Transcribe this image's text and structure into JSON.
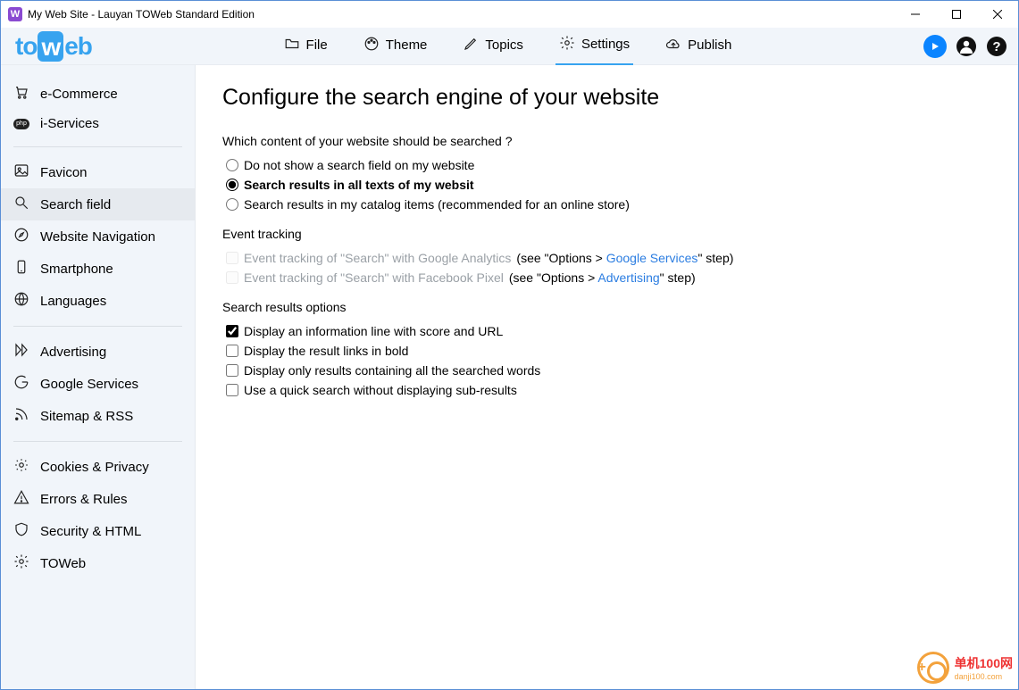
{
  "window": {
    "title": "My Web Site - Lauyan TOWeb Standard Edition"
  },
  "logo": {
    "pre": "to",
    "mid": "w",
    "post": "eb"
  },
  "topnav": {
    "file": "File",
    "theme": "Theme",
    "topics": "Topics",
    "settings": "Settings",
    "publish": "Publish"
  },
  "sidebar": {
    "ecommerce": "e-Commerce",
    "iservices": "i-Services",
    "favicon": "Favicon",
    "searchfield": "Search field",
    "nav": "Website Navigation",
    "smartphone": "Smartphone",
    "languages": "Languages",
    "advertising": "Advertising",
    "google": "Google Services",
    "sitemap": "Sitemap & RSS",
    "cookies": "Cookies & Privacy",
    "errors": "Errors & Rules",
    "security": "Security & HTML",
    "toweb": "TOWeb"
  },
  "page": {
    "title": "Configure the search engine of your website",
    "searchedQ": "Which content of your website should be searched ?",
    "r1": "Do not show a search field on my website",
    "r2": "Search results in all texts of my websit",
    "r3": "Search results in my catalog items (recommended for an online store)",
    "evtTitle": "Event tracking",
    "evt1": "Event tracking of \"Search\" with Google Analytics",
    "evt1hint_a": " (see \"Options > ",
    "evt1link": "Google Services",
    "evt1hint_b": "\" step)",
    "evt2": "Event tracking of \"Search\" with Facebook Pixel",
    "evt2hint_a": " (see \"Options > ",
    "evt2link": "Advertising",
    "evt2hint_b": "\" step)",
    "resTitle": "Search results options",
    "c1": "Display an information line with score and URL",
    "c2": "Display the result links in bold",
    "c3": "Display only results containing all the searched words",
    "c4": "Use a quick search without displaying sub-results"
  },
  "watermark": {
    "line1": "单机100网",
    "line2": "danji100.com"
  }
}
